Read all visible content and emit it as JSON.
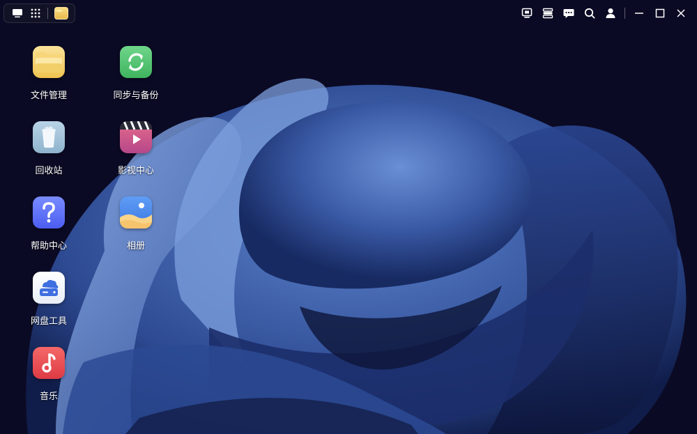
{
  "taskbar": {
    "left_icons": [
      "desktop-icon",
      "app-grid-icon",
      "file-manager-icon"
    ],
    "right_icons": [
      "monitor-icon",
      "storage-icon",
      "chat-icon",
      "search-icon",
      "user-icon",
      "minimize-icon",
      "maximize-icon",
      "close-icon"
    ]
  },
  "desktop": {
    "apps": [
      {
        "label": "文件管理",
        "icon": "folder-icon"
      },
      {
        "label": "同步与备份",
        "icon": "sync-icon"
      },
      {
        "label": "回收站",
        "icon": "trash-icon"
      },
      {
        "label": "影视中心",
        "icon": "video-icon"
      },
      {
        "label": "帮助中心",
        "icon": "help-icon"
      },
      {
        "label": "相册",
        "icon": "photo-icon"
      },
      {
        "label": "网盘工具",
        "icon": "cloud-disk-icon"
      },
      {
        "label": "音乐",
        "icon": "music-icon"
      }
    ]
  },
  "colors": {
    "background": "#0b0a24",
    "wallpaper_light": "#5b7fc8",
    "wallpaper_dark": "#1d2a5c"
  }
}
